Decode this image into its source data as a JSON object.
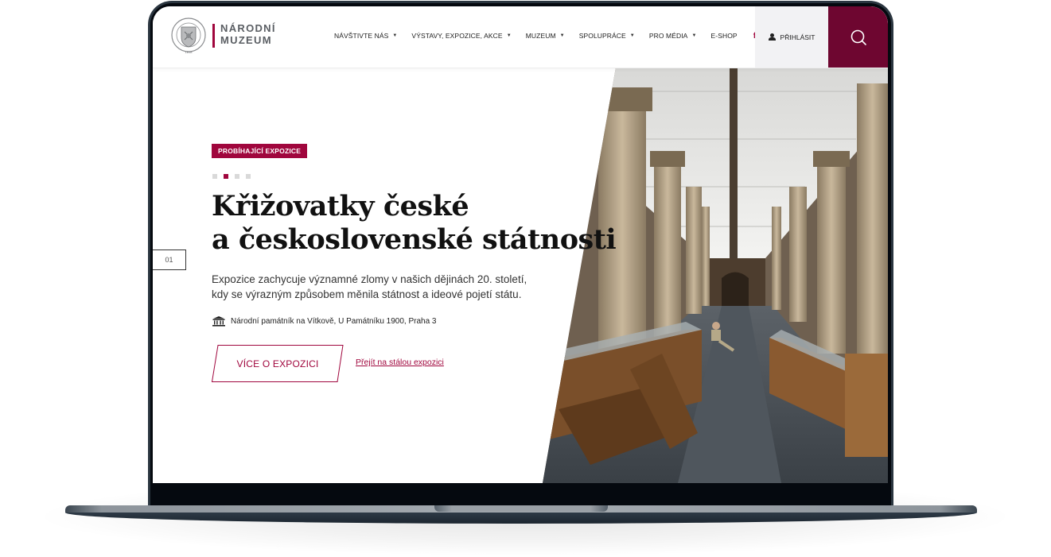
{
  "site": {
    "logo_text_line1": "NÁRODNÍ",
    "logo_text_line2": "MUZEUM",
    "brand_color": "#a0063d",
    "search_bg_color": "#6e0630"
  },
  "nav": {
    "items": [
      {
        "label": "NÁVŠTIVTE NÁS",
        "has_dropdown": true
      },
      {
        "label": "VÝSTAVY, EXPOZICE, AKCE",
        "has_dropdown": true
      },
      {
        "label": "MUZEUM",
        "has_dropdown": true
      },
      {
        "label": "SPOLUPRÁCE",
        "has_dropdown": true
      },
      {
        "label": "PRO MÉDIA",
        "has_dropdown": true
      },
      {
        "label": "E-SHOP",
        "has_dropdown": false
      }
    ],
    "caret": "▼",
    "social": {
      "facebook": "f",
      "twitter": "twitter-icon",
      "instagram": "instagram-icon"
    },
    "login_label": "PŘIHLÁSIT",
    "search_icon": "search-icon"
  },
  "hero": {
    "badge": "PROBÍHAJÍCÍ EXPOZICE",
    "slides_total": 4,
    "active_slide": 2,
    "slide_number": "01",
    "title_line1": "Křižovatky české",
    "title_line2": "a československé státnosti",
    "description_line1": "Expozice zachycuje významné zlomy v našich dějinách 20. století,",
    "description_line2": "kdy se výrazným způsobem měnila státnost a ideové pojetí státu.",
    "location": "Národní památník na Vítkově, U Památníku 1900, Praha 3",
    "cta_label": "VÍCE O EXPOZICI",
    "secondary_link": "Přejít na stálou expozici",
    "image_alt": "Museum hall with stone columns and wooden display cases"
  }
}
